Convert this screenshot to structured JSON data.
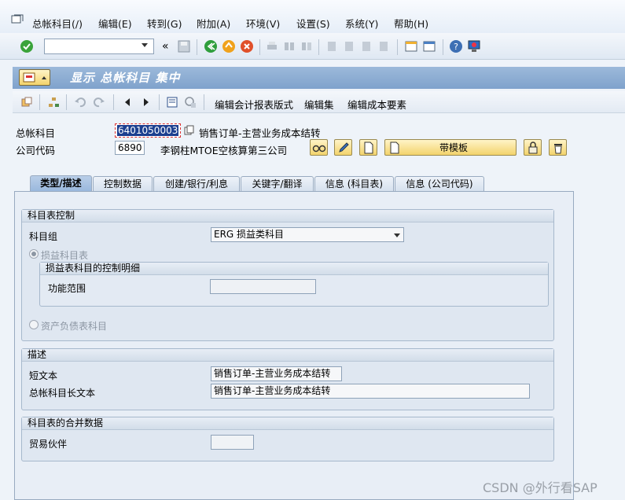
{
  "menu": [
    "总帐科目(/)",
    "编辑(E)",
    "转到(G)",
    "附加(A)",
    "环境(V)",
    "设置(S)",
    "系统(Y)",
    "帮助(H)"
  ],
  "system_toolbar": {
    "command_field_value": "",
    "back_glyph": "«"
  },
  "screen_title": "显示 总帐科目 集中",
  "app_toolbar": {
    "edit_fs_version": "编辑会计报表版式",
    "edit_set": "编辑集",
    "edit_cost_element": "编辑成本要素"
  },
  "header": {
    "gl_account_label": "总帐科目",
    "gl_account_value": "6401050003",
    "gl_account_desc": "销售订单-主营业务成本结转",
    "company_code_label": "公司代码",
    "company_code_value": "6890",
    "company_code_desc": "李钢柱MTOE空核算第三公司",
    "template_button": "带模板"
  },
  "tabs": [
    "类型/描述",
    "控制数据",
    "创建/银行/利息",
    "关键字/翻译",
    "信息 (科目表)",
    "信息 (公司代码)"
  ],
  "coa_control": {
    "title": "科目表控制",
    "account_group_label": "科目组",
    "account_group_value": "ERG 损益类科目",
    "pl_radio_label": "损益科目表",
    "pl_detail_title": "损益表科目的控制明细",
    "functional_area_label": "功能范围",
    "functional_area_value": "",
    "bs_radio_label": "资产负债表科目"
  },
  "description": {
    "title": "描述",
    "short_text_label": "短文本",
    "short_text_value": "销售订单-主营业务成本结转",
    "long_text_label": "总帐科目长文本",
    "long_text_value": "销售订单-主营业务成本结转"
  },
  "consolidation": {
    "title": "科目表的合并数据",
    "trading_partner_label": "贸易伙伴",
    "trading_partner_value": ""
  },
  "watermark": "CSDN @外行看SAP",
  "colors": {
    "title_bar": "#8fafd6",
    "tab_active": "#a9c4e5",
    "button_yellow": "#f3d36c",
    "selection": "#1c3f8f"
  }
}
